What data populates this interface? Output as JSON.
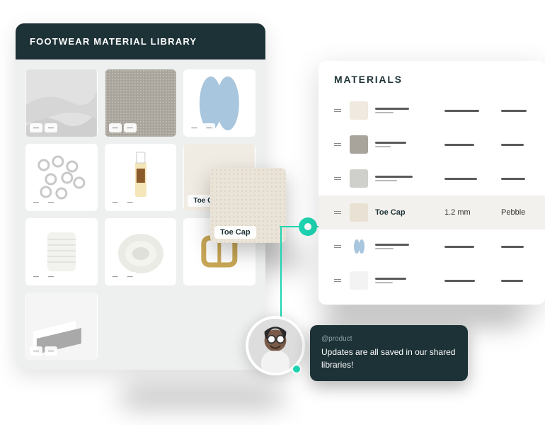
{
  "library": {
    "title": "FOOTWEAR MATERIAL LIBRARY",
    "items": [
      {
        "name": "fabric-folded",
        "meta1": "",
        "meta2": ""
      },
      {
        "name": "mesh-gray",
        "meta1": "",
        "meta2": ""
      },
      {
        "name": "insoles-blue",
        "meta1": "",
        "meta2": ""
      },
      {
        "name": "eyelets-white",
        "meta1": "",
        "meta2": ""
      },
      {
        "name": "glue-bottle",
        "meta1": "",
        "meta2": ""
      },
      {
        "name": "leather-swatch",
        "label": "Toe Cap"
      },
      {
        "name": "thread-spool",
        "meta1": "",
        "meta2": ""
      },
      {
        "name": "white-laces",
        "meta1": "",
        "meta2": ""
      },
      {
        "name": "brass-buckle"
      },
      {
        "name": "foam-sheets",
        "meta1": "",
        "meta2": ""
      }
    ]
  },
  "float_card": {
    "label": "Toe Cap"
  },
  "table": {
    "title": "MATERIALS",
    "rows": [
      {
        "highlight": false
      },
      {
        "highlight": false
      },
      {
        "highlight": false
      },
      {
        "highlight": true,
        "name": "Toe Cap",
        "col2": "1.2 mm",
        "col3": "Pebble"
      },
      {
        "highlight": false
      },
      {
        "highlight": false
      }
    ]
  },
  "comment": {
    "handle": "@product",
    "message": "Updates are all saved in our shared libraries!"
  },
  "thumbs": {
    "fabric": "#d8d8d8",
    "mesh": "#aaa69e",
    "insole": "#a8c6de",
    "eyelet": "#f4f4f4",
    "glue": "#f0ece4",
    "leather": "#f1ece3",
    "pebble": "#eae3d7",
    "thread": "#f6f6f2",
    "laces": "#e8e8e2",
    "buckle": "#e9e3d4",
    "foam": "#dedede",
    "row1": "#efe9df",
    "row2": "#a8a49c",
    "row3": "#cfcfcb",
    "row4": "#e9e1d3",
    "row5": "#a8c6de",
    "row6": "#f3f3f3"
  }
}
